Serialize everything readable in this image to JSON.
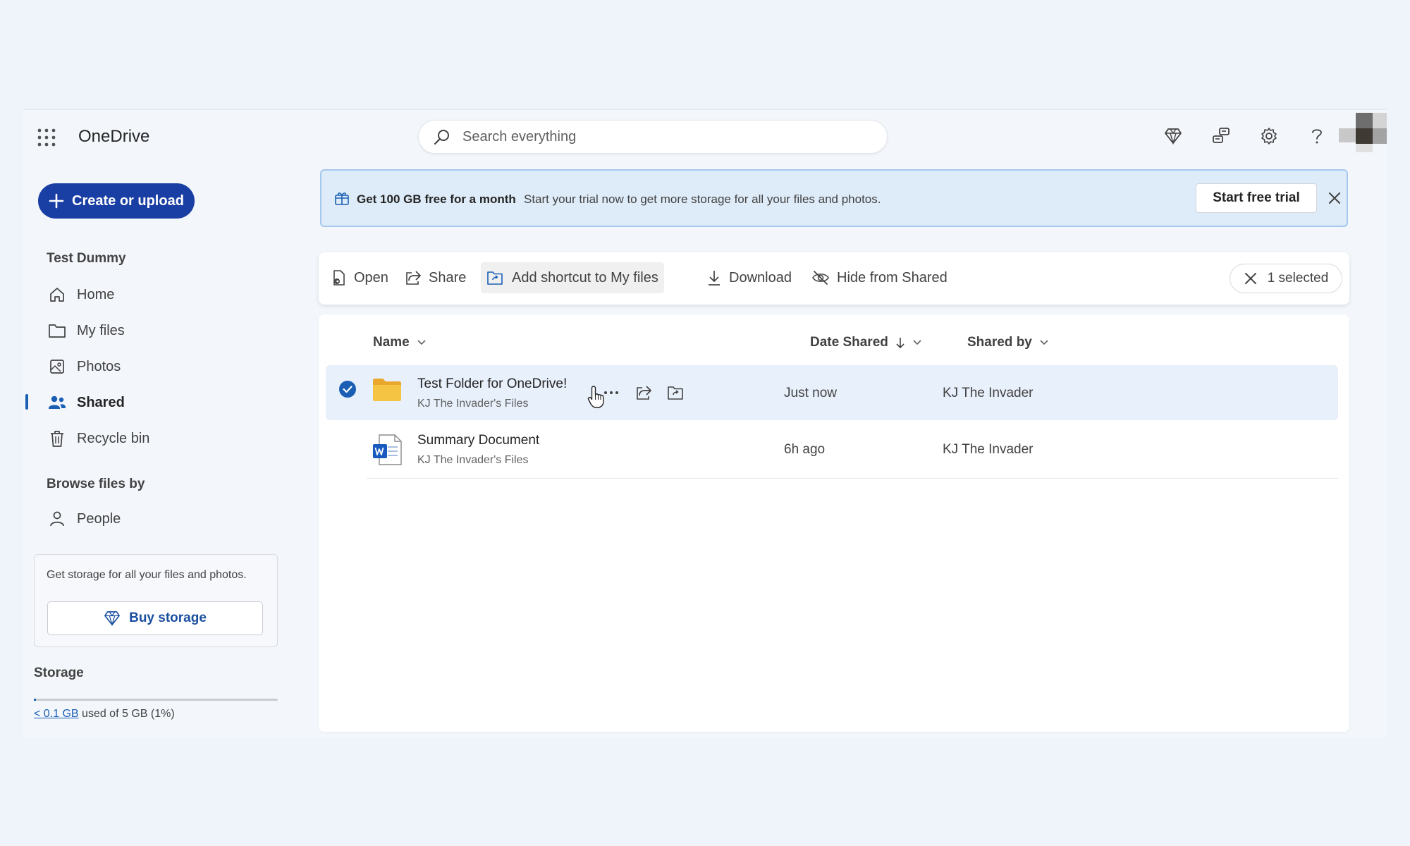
{
  "app": {
    "name": "OneDrive"
  },
  "search": {
    "placeholder": "Search everything"
  },
  "header_icons": [
    "premium-diamond-icon",
    "share-feedback-icon",
    "settings-gear-icon",
    "help-question-icon"
  ],
  "sidebar": {
    "create_label": "Create or upload",
    "user_name": "Test Dummy",
    "items": [
      {
        "label": "Home",
        "icon": "home-icon"
      },
      {
        "label": "My files",
        "icon": "folder-icon"
      },
      {
        "label": "Photos",
        "icon": "photo-icon"
      },
      {
        "label": "Shared",
        "icon": "people-icon",
        "active": true
      },
      {
        "label": "Recycle bin",
        "icon": "trash-icon"
      }
    ],
    "browse_title": "Browse files by",
    "browse_items": [
      {
        "label": "People",
        "icon": "person-icon"
      }
    ],
    "promo_text": "Get storage for all your files and photos.",
    "buy_label": "Buy storage",
    "storage_title": "Storage",
    "storage_used": "< 0.1 GB",
    "storage_rest": " used of 5 GB (1%)",
    "storage_fraction": 0.01
  },
  "banner": {
    "headline": "Get 100 GB free for a month",
    "text": "Start your trial now to get more storage for all your files and photos.",
    "button": "Start free trial"
  },
  "commands": {
    "open": "Open",
    "share": "Share",
    "add_shortcut": "Add shortcut to My files",
    "download": "Download",
    "hide": "Hide from Shared",
    "selected": "1 selected"
  },
  "columns": {
    "name": "Name",
    "date": "Date Shared",
    "shared_by": "Shared by"
  },
  "files": [
    {
      "name": "Test Folder for OneDrive!",
      "location": "KJ The Invader's Files",
      "date": "Just now",
      "shared_by": "KJ The Invader",
      "type": "folder",
      "selected": true
    },
    {
      "name": "Summary Document",
      "location": "KJ The Invader's Files",
      "date": "6h ago",
      "shared_by": "KJ The Invader",
      "type": "word",
      "selected": false
    }
  ],
  "colors": {
    "accent": "#1a3fa4",
    "selection": "#e8f0fb",
    "banner_bg": "#deebf8",
    "folder": "#f5c443",
    "word": "#185abd"
  }
}
